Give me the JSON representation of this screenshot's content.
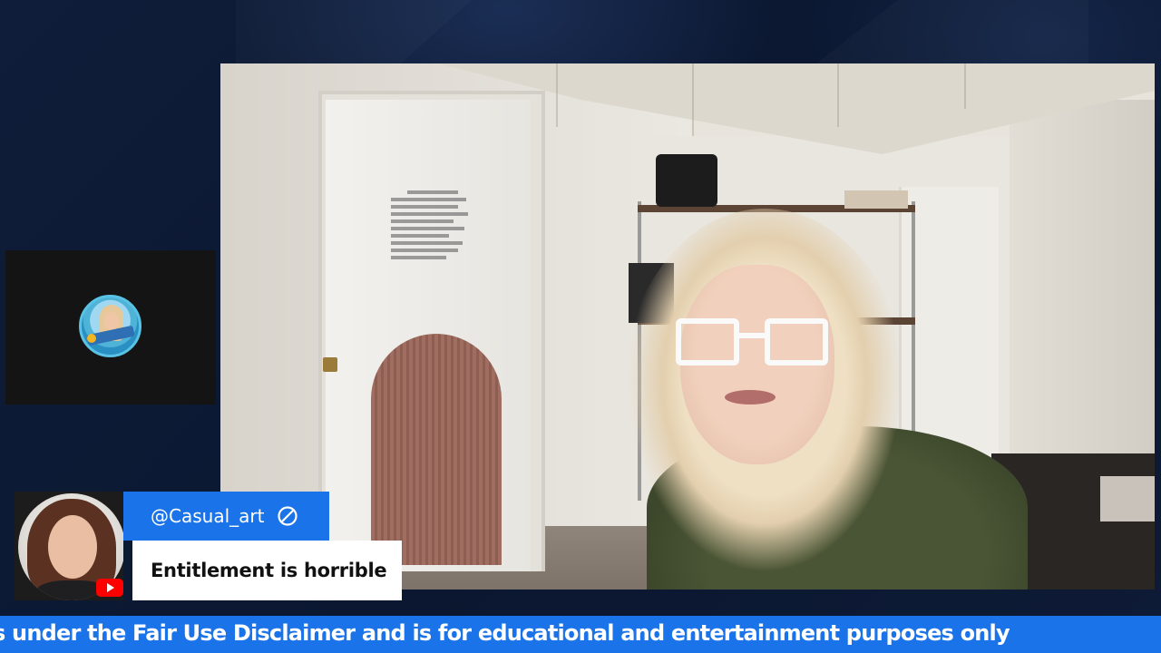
{
  "chat": {
    "username": "@Casual_art",
    "message": "Entitlement is horrible",
    "platform_icon": "youtube-icon",
    "moderation_icon": "ban-icon"
  },
  "ticker": {
    "text": "s under the Fair Use Disclaimer and is for educational and entertainment purposes only"
  },
  "colors": {
    "accent": "#1a73e8",
    "background": "#0d1a33",
    "youtube_red": "#ff0000"
  }
}
